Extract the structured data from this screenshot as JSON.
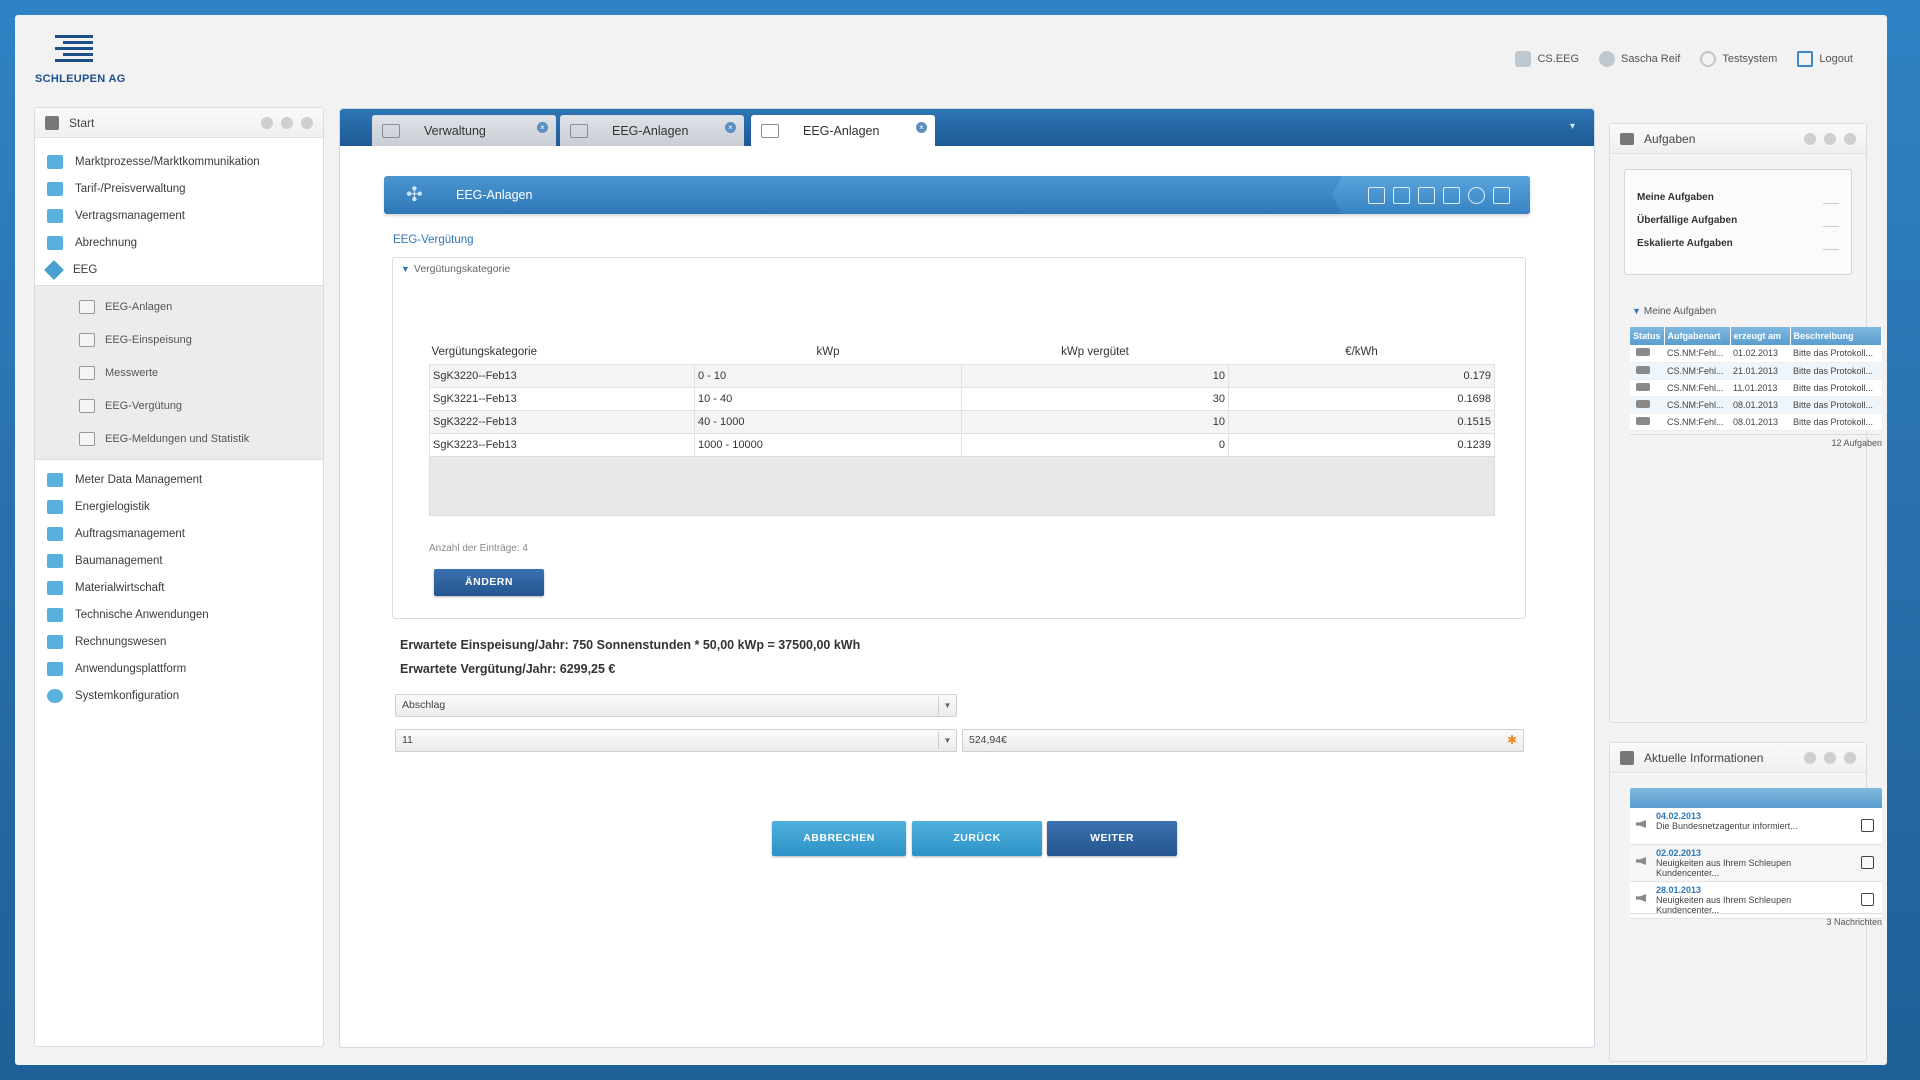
{
  "header": {
    "logo_text": "SCHLEUPEN AG",
    "nav": [
      {
        "label": "CS.EEG",
        "icon": "database-icon"
      },
      {
        "label": "Sascha Reif",
        "icon": "user-icon"
      },
      {
        "label": "Testsystem",
        "icon": "globe-icon"
      },
      {
        "label": "Logout",
        "icon": "logout-icon"
      }
    ]
  },
  "sidebar": {
    "title": "Start",
    "items": [
      {
        "label": "Marktprozesse/Marktkommunikation"
      },
      {
        "label": "Tarif-/Preisverwaltung"
      },
      {
        "label": "Vertragsmanagement"
      },
      {
        "label": "Abrechnung"
      },
      {
        "label": "EEG"
      }
    ],
    "eeg_sub": [
      {
        "label": "EEG-Anlagen"
      },
      {
        "label": "EEG-Einspeisung"
      },
      {
        "label": "Messwerte"
      },
      {
        "label": "EEG-Vergütung"
      },
      {
        "label": "EEG-Meldungen und Statistik"
      }
    ],
    "items2": [
      {
        "label": "Meter Data Management"
      },
      {
        "label": "Energielogistik"
      },
      {
        "label": "Auftragsmanagement"
      },
      {
        "label": "Baumanagement"
      },
      {
        "label": "Materialwirtschaft"
      },
      {
        "label": "Technische Anwendungen"
      },
      {
        "label": "Rechnungswesen"
      },
      {
        "label": "Anwendungsplattform"
      },
      {
        "label": "Systemkonfiguration"
      }
    ]
  },
  "tabs": [
    {
      "label": "Verwaltung",
      "active": false
    },
    {
      "label": "EEG-Anlagen",
      "active": false
    },
    {
      "label": "EEG-Anlagen",
      "active": true
    }
  ],
  "banner": {
    "title": "EEG-Anlagen"
  },
  "section": {
    "link": "EEG-Vergütung",
    "legend": "Vergütungskategorie",
    "columns": [
      "Vergütungskategorie",
      "kWp",
      "kWp vergütet",
      "€/kWh"
    ],
    "rows": [
      [
        "SgK3220--Feb13",
        "0 - 10",
        "10",
        "0.179"
      ],
      [
        "SgK3221--Feb13",
        "10 - 40",
        "30",
        "0.1698"
      ],
      [
        "SgK3222--Feb13",
        "40 - 1000",
        "10",
        "0.1515"
      ],
      [
        "SgK3223--Feb13",
        "1000 - 10000",
        "0",
        "0.1239"
      ]
    ],
    "count_label": "Anzahl der Einträge: 4",
    "change_button": "ÄNDERN"
  },
  "calc": {
    "line1": "Erwartete Einspeisung/Jahr: 750 Sonnenstunden * 50,00 kWp = 37500,00 kWh",
    "line2": "Erwartete Vergütung/Jahr: 6299,25 €"
  },
  "form": {
    "select1": "Abschlag",
    "select2": "11",
    "amount": "524,94€"
  },
  "actions": {
    "cancel": "ABBRECHEN",
    "back": "ZURÜCK",
    "next": "WEITER"
  },
  "tasks_panel": {
    "title": "Aufgaben",
    "summary": [
      {
        "label": "Meine Aufgaben"
      },
      {
        "label": "Überfällige Aufgaben"
      },
      {
        "label": "Eskalierte Aufgaben"
      }
    ],
    "subhead": "Meine Aufgaben",
    "columns": [
      "Status",
      "Aufgabenart",
      "erzeugt am",
      "Beschreibung"
    ],
    "rows": [
      [
        "CS.NM:Fehl...",
        "01.02.2013",
        "Bitte das Protokoll..."
      ],
      [
        "CS.NM:Fehl...",
        "21.01.2013",
        "Bitte das Protokoll..."
      ],
      [
        "CS.NM:Fehl...",
        "11.01.2013",
        "Bitte das Protokoll..."
      ],
      [
        "CS.NM:Fehl...",
        "08.01.2013",
        "Bitte das Protokoll..."
      ],
      [
        "CS.NM:Fehl...",
        "08.01.2013",
        "Bitte das Protokoll..."
      ]
    ],
    "footer": "12 Aufgaben"
  },
  "news_panel": {
    "title": "Aktuelle Informationen",
    "items": [
      {
        "date": "04.02.2013",
        "text": "Die Bundesnetzagentur informiert..."
      },
      {
        "date": "02.02.2013",
        "text": "Neuigkeiten aus Ihrem Schleupen Kundencenter..."
      },
      {
        "date": "28.01.2013",
        "text": "Neuigkeiten aus Ihrem Schleupen Kundencenter..."
      }
    ],
    "footer": "3 Nachrichten"
  },
  "colors": {
    "brand": "#1d4f8a",
    "accent": "#2d76b8",
    "star": "#f08a24"
  }
}
